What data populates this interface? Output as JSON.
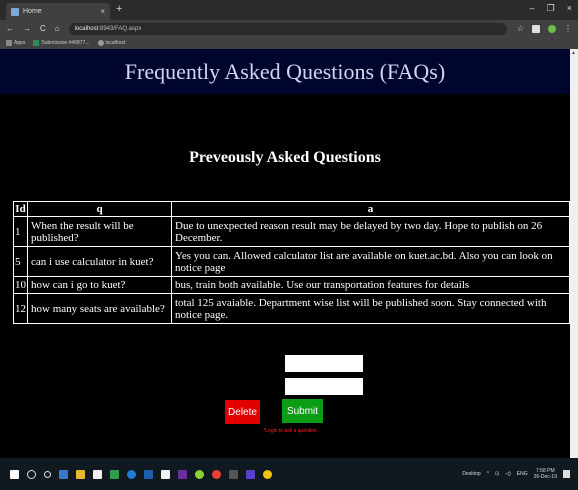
{
  "browser": {
    "tab_title": "Home",
    "tab_close": "×",
    "new_tab": "+",
    "window_controls": [
      "–",
      "❐",
      "×"
    ],
    "nav_buttons": [
      "←",
      "→",
      "C",
      "⌂"
    ],
    "address_host": "localhost",
    "address_path": ":8943/FAQ.aspx",
    "star": "☆",
    "menu": "⋮",
    "bookmarks": [
      "Apps",
      "Submission #46877...",
      "localhost"
    ]
  },
  "page": {
    "header_title": "Frequently Asked Questions (FAQs)",
    "section_title": "Preveously Asked Questions",
    "table": {
      "headers": [
        "Id",
        "q",
        "a"
      ],
      "rows": [
        {
          "id": "1",
          "q": "When the result will be published?",
          "a": "Due to unexpected reason result may be delayed by two day. Hope to publish on 26 December."
        },
        {
          "id": "5",
          "q": "can i use calculator in kuet?",
          "a": "Yes you can. Allowed calculator list are available on kuet.ac.bd. Also you can look on notice page"
        },
        {
          "id": "10",
          "q": "how can i go to kuet?",
          "a": "bus, train both available. Use our transportation features for details"
        },
        {
          "id": "12",
          "q": "how many seats are available?",
          "a": "total 125 avaiable. Department wise list will be published soon. Stay connected with notice page."
        }
      ]
    },
    "input1_value": "",
    "input2_value": "",
    "delete_label": "Delete",
    "submit_label": "Submit",
    "login_message": "*Login to ask a question"
  },
  "taskbar": {
    "desktop_label": "Desktop",
    "language": "ENG",
    "time": "7:58 PM",
    "date": "26-Dec-19"
  },
  "colors": {
    "header_bg": "#00052e",
    "delete_bg": "#e00000",
    "submit_bg": "#0c9d16",
    "login_msg": "#ff2222"
  }
}
